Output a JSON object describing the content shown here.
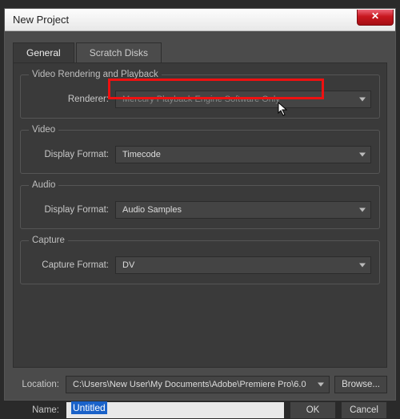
{
  "titlebar": {
    "text": "New Project",
    "close_glyph": "✕"
  },
  "tabs": {
    "general": "General",
    "scratch": "Scratch Disks"
  },
  "sections": {
    "render": {
      "legend": "Video Rendering and Playback",
      "renderer_label": "Renderer:",
      "renderer_value": "Mercury Playback Engine Software Only"
    },
    "video": {
      "legend": "Video",
      "format_label": "Display Format:",
      "format_value": "Timecode"
    },
    "audio": {
      "legend": "Audio",
      "format_label": "Display Format:",
      "format_value": "Audio Samples"
    },
    "capture": {
      "legend": "Capture",
      "format_label": "Capture Format:",
      "format_value": "DV"
    }
  },
  "footer": {
    "location_label": "Location:",
    "location_value": "C:\\Users\\New User\\My Documents\\Adobe\\Premiere Pro\\6.0",
    "browse": "Browse...",
    "name_label": "Name:",
    "name_value": "Untitled",
    "ok": "OK",
    "cancel": "Cancel"
  }
}
